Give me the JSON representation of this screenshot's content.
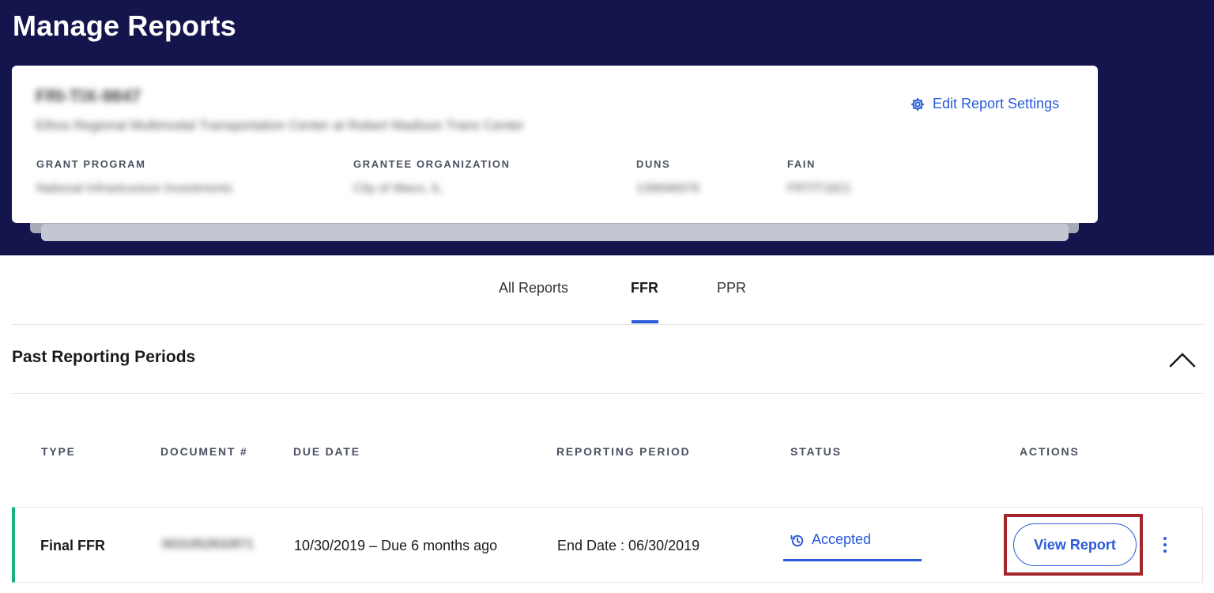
{
  "page": {
    "title": "Manage Reports"
  },
  "card": {
    "id_redacted": "FRI-TIX-9847",
    "name_redacted": "Ethos Regional Multimodal Transportation Center at Robert Madison Trans Center",
    "edit_settings_label": "Edit Report Settings",
    "fields": [
      {
        "label": "GRANT PROGRAM",
        "value_redacted": "National Infrastructure Investments"
      },
      {
        "label": "GRANTEE ORGANIZATION",
        "value_redacted": "City of Waco, IL"
      },
      {
        "label": "DUNS",
        "value_redacted": "139846976"
      },
      {
        "label": "FAIN",
        "value_redacted": "FRTIT1821"
      }
    ]
  },
  "tabs": [
    {
      "label": "All Reports",
      "active": false
    },
    {
      "label": "FFR",
      "active": true
    },
    {
      "label": "PPR",
      "active": false
    }
  ],
  "section": {
    "title": "Past Reporting Periods"
  },
  "table": {
    "columns": [
      "TYPE",
      "DOCUMENT #",
      "DUE DATE",
      "REPORTING PERIOD",
      "STATUS",
      "ACTIONS"
    ],
    "rows": [
      {
        "type": "Final FFR",
        "document_redacted": "0031952832871",
        "due_date": "10/30/2019 – Due 6 months ago",
        "reporting_period": "End Date : 06/30/2019",
        "status": "Accepted",
        "action_label": "View Report"
      }
    ]
  },
  "colors": {
    "banner": "#15154d",
    "accent": "#2b5bd8",
    "row_marker": "#1bb37a",
    "highlight": "#a3262a"
  },
  "icons": {
    "edit_settings": "gear-icon",
    "status": "history-icon",
    "collapse": "chevron-up-icon",
    "row_menu": "kebab-menu-icon"
  }
}
